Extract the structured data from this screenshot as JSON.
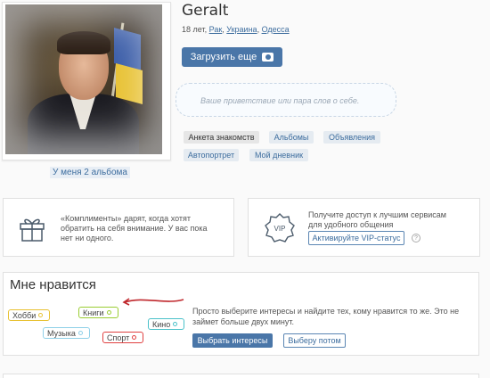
{
  "profile": {
    "name": "Geralt",
    "age": "18 лет,",
    "zodiac": "Рак",
    "country": "Украина",
    "city": "Одесса",
    "albums_link": "У меня 2 альбома",
    "upload_label": "Загрузить еще",
    "greeting_placeholder": "Ваше приветствие или пара слов о себе."
  },
  "nav_tags": [
    "Анкета знакомств",
    "Альбомы",
    "Объявления",
    "Автопортрет",
    "Мой дневник"
  ],
  "compliments": {
    "text": "«Комплименты» дарят, когда хотят обратить на себя внимание. У вас пока нет ни одного."
  },
  "vip": {
    "icon_text": "VIP",
    "text": "Получите доступ к лучшим сервисам для удобного общения",
    "button": "Активируйте VIP-статус",
    "help": "?"
  },
  "likes": {
    "title": "Мне нравится",
    "interests": [
      "Хобби",
      "Книги",
      "Музыка",
      "Кино",
      "Спорт"
    ],
    "text": "Просто выберите интересы и найдите тех, кому нравится то же. Это не займет больше двух минут.",
    "choose_button": "Выбрать интересы",
    "later_button": "Выберу потом"
  },
  "colors": {
    "accent": "#4a76a8",
    "link": "#3d6d9e"
  }
}
